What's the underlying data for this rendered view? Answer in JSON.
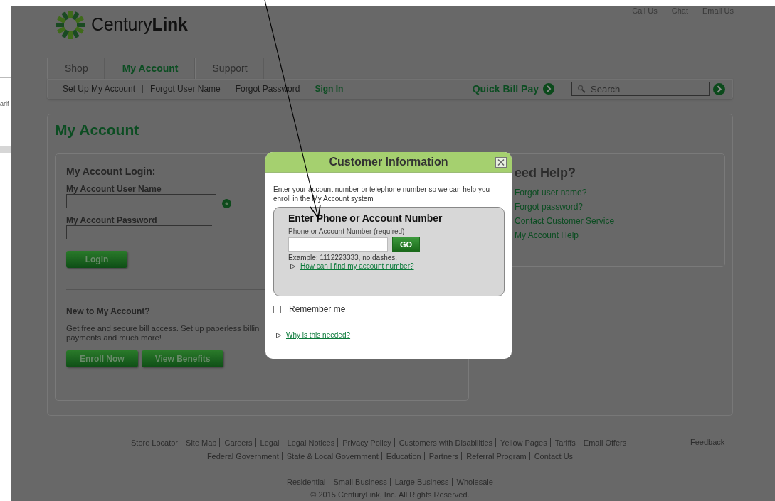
{
  "background_window": {
    "text": "arif"
  },
  "top_links": [
    "Call Us",
    "Chat",
    "Email Us"
  ],
  "logo": {
    "text": "Century**Link**"
  },
  "tabs": [
    {
      "label": "Shop",
      "selected": false
    },
    {
      "label": "My Account",
      "selected": true
    },
    {
      "label": "Support",
      "selected": false
    }
  ],
  "subnav": [
    {
      "label": "Set Up My Account",
      "kind": "plain"
    },
    {
      "label": "Forgot User Name",
      "kind": "plain"
    },
    {
      "label": "Forgot Password",
      "kind": "plain"
    },
    {
      "label": "Sign In",
      "kind": "strong"
    }
  ],
  "quick_bill_pay": "Quick Bill Pay",
  "search": {
    "placeholder": "Search"
  },
  "page_title": "My Account",
  "login": {
    "title": "My Account Login:",
    "user_label": "My Account User Name",
    "password_label": "My Account Password",
    "button": "Login"
  },
  "new_account": {
    "title": "New to My Account?",
    "lines": [
      "Get free and secure bill access. Set up paperless billin",
      "payments and much more!"
    ],
    "buttons": [
      "Enroll Now",
      "View Benefits"
    ]
  },
  "help": {
    "title": "eed Help?",
    "links": [
      "Forgot user name?",
      "Forgot password?",
      "Contact Customer Service",
      "My Account Help"
    ]
  },
  "modal": {
    "title": "Customer Information",
    "intro": "Enter your account number or telephone number so we can help you enroll in the My Account system",
    "section_title": "Enter Phone or Account Number",
    "field_label": "Phone or Account Number (required)",
    "go_button": "GO",
    "example": "Example: 1112223333, no dashes.",
    "find_link": "How can I find my account number?",
    "remember": {
      "label": "Remember me",
      "checked": false
    },
    "why_link": "Why is this needed?"
  },
  "footer": {
    "link_lines": [
      {
        "links": [
          "Store Locator",
          "Site Map",
          "Careers",
          "Legal",
          "Legal Notices",
          "Privacy Policy",
          "Customers with Disabilities",
          "Yellow Pages",
          "Tariffs",
          "Email Offers"
        ]
      },
      {
        "links": [
          "Federal Government",
          "State & Local Government",
          "Education",
          "Partners",
          "Referral Program",
          "Contact Us"
        ]
      },
      {
        "links": [
          "Residential",
          "Small Business",
          "Large Business",
          "Wholesale"
        ]
      }
    ],
    "feedback": "Feedback",
    "copyright": "© 2015 CenturyLink, Inc. All Rights Reserved."
  }
}
